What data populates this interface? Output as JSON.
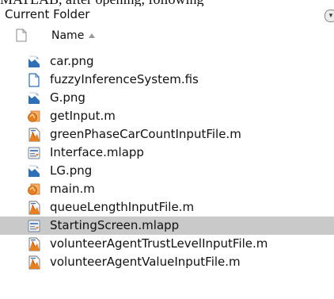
{
  "header_cut_text": "MATLAB, after opening, following",
  "panel": {
    "title": "Current Folder",
    "menu_glyph": "▾"
  },
  "columns": {
    "name_label": "Name",
    "sort": "ascending"
  },
  "files": [
    {
      "name": "car.png",
      "icon": "png-image-icon"
    },
    {
      "name": "fuzzyInferenceSystem.fis",
      "icon": "blank-file-icon"
    },
    {
      "name": "G.png",
      "icon": "png-image-icon"
    },
    {
      "name": "getInput.m",
      "icon": "matlab-function-icon"
    },
    {
      "name": "greenPhaseCarCountInputFile.m",
      "icon": "matlab-script-icon"
    },
    {
      "name": "Interface.mlapp",
      "icon": "mlapp-icon"
    },
    {
      "name": "LG.png",
      "icon": "png-image-icon"
    },
    {
      "name": "main.m",
      "icon": "matlab-function-icon"
    },
    {
      "name": "queueLengthInputFile.m",
      "icon": "matlab-script-icon"
    },
    {
      "name": "StartingScreen.mlapp",
      "icon": "mlapp-icon",
      "selected": true
    },
    {
      "name": "volunteerAgentTrustLevelInputFile.m",
      "icon": "matlab-script-icon"
    },
    {
      "name": "volunteerAgentValueInputFile.m",
      "icon": "matlab-script-icon"
    }
  ],
  "colors": {
    "selected_row": "#c9c9c9",
    "matlab_orange": "#e8801f",
    "image_blue": "#2f6fb6"
  }
}
